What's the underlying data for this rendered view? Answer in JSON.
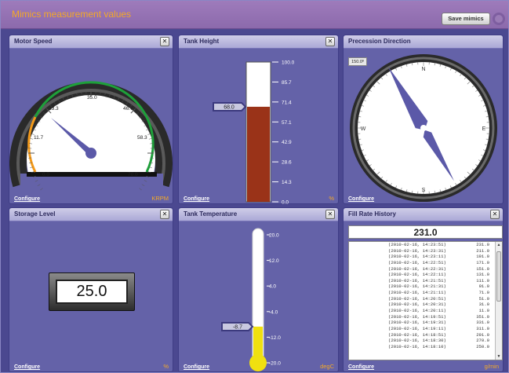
{
  "header": {
    "title": "Mimics measurement values",
    "save_label": "Save mimics"
  },
  "common": {
    "configure_label": "Configure",
    "close_glyph": "✕"
  },
  "panels": {
    "motor_speed": {
      "title": "Motor Speed",
      "unit": "KRPM",
      "ticks": [
        "0.0",
        "11.7",
        "23.3",
        "35.0",
        "46.7",
        "58.3",
        "70.0"
      ],
      "value": 22.4,
      "min": 0,
      "max": 70
    },
    "tank_height": {
      "title": "Tank Height",
      "unit": "%",
      "ticks": [
        "100.0",
        "85.7",
        "71.4",
        "57.1",
        "42.9",
        "28.6",
        "14.3",
        "0.0"
      ],
      "value": 68.0,
      "value_label": "68.0",
      "fill_color": "#9a3318"
    },
    "precession": {
      "title": "Precession Direction",
      "value_label": "150.0º",
      "value": 150,
      "cardinals": {
        "n": "N",
        "e": "E",
        "s": "S",
        "w": "W"
      }
    },
    "storage": {
      "title": "Storage Level",
      "unit": "%",
      "value_label": "25.0"
    },
    "tank_temp": {
      "title": "Tank Temperature",
      "unit": "degC",
      "ticks": [
        "20.0",
        "12.0",
        "4.0",
        "-4.0",
        "-12.0",
        "-20.0"
      ],
      "value": -8.7,
      "value_label": "-8.7",
      "fill_color": "#f0e010"
    },
    "fill_rate": {
      "title": "Fill Rate History",
      "unit": "g/min",
      "current": "231.0",
      "rows": [
        [
          "(2010-02-16, 14:23:51)",
          "231.0"
        ],
        [
          "(2010-02-16, 14:23:31)",
          "211.0"
        ],
        [
          "(2010-02-16, 14:23:11)",
          "191.0"
        ],
        [
          "(2010-02-16, 14:22:51)",
          "171.0"
        ],
        [
          "(2010-02-16, 14:22:31)",
          "151.0"
        ],
        [
          "(2010-02-16, 14:22:11)",
          "131.0"
        ],
        [
          "(2010-02-16, 14:21:51)",
          "111.0"
        ],
        [
          "(2010-02-16, 14:21:31)",
          "91.0"
        ],
        [
          "(2010-02-16, 14:21:11)",
          "71.0"
        ],
        [
          "(2010-02-16, 14:20:51)",
          "51.0"
        ],
        [
          "(2010-02-16, 14:20:31)",
          "31.0"
        ],
        [
          "(2010-02-16, 14:20:11)",
          "11.0"
        ],
        [
          "(2010-02-16, 14:19:51)",
          "351.0"
        ],
        [
          "(2010-02-16, 14:19:31)",
          "331.0"
        ],
        [
          "(2010-02-16, 14:19:11)",
          "311.0"
        ],
        [
          "(2010-02-16, 14:18:51)",
          "291.0"
        ],
        [
          "(2010-02-16, 14:18:30)",
          "270.0"
        ],
        [
          "(2010-02-16, 14:18:10)",
          "250.0"
        ]
      ]
    }
  }
}
